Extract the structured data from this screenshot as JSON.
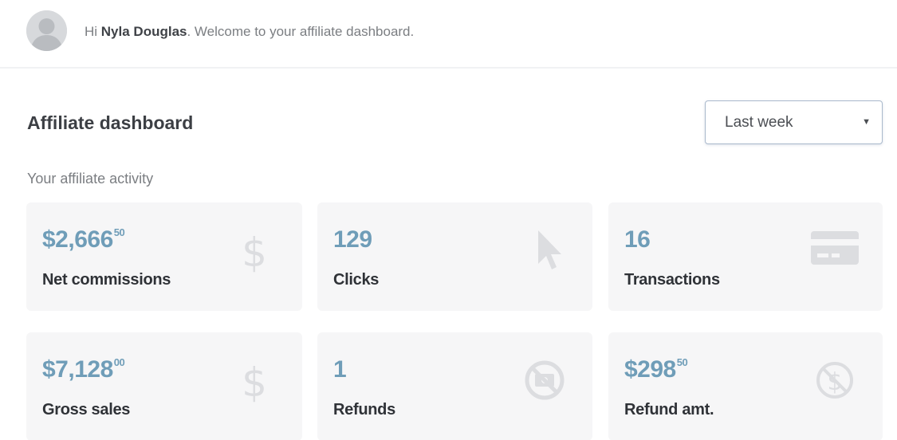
{
  "greeting": {
    "prefix": "Hi ",
    "name": "Nyla Douglas",
    "suffix": ". Welcome to your affiliate dashboard."
  },
  "dashboard": {
    "title": "Affiliate dashboard",
    "period_select": {
      "value": "Last week"
    },
    "activity_label": "Your affiliate activity"
  },
  "stats": {
    "net_commissions": {
      "main": "$2,666",
      "cents": "50",
      "label": "Net commissions",
      "icon": "dollar-icon"
    },
    "clicks": {
      "main": "129",
      "label": "Clicks",
      "icon": "cursor-icon"
    },
    "transactions": {
      "main": "16",
      "label": "Transactions",
      "icon": "credit-card-icon"
    },
    "gross_sales": {
      "main": "$7,128",
      "cents": "00",
      "label": "Gross sales",
      "icon": "dollar-icon"
    },
    "refunds": {
      "main": "1",
      "label": "Refunds",
      "icon": "no-refund-icon"
    },
    "refund_amount": {
      "main": "$298",
      "cents": "50",
      "label": "Refund amt.",
      "icon": "no-dollar-icon"
    }
  },
  "colors": {
    "value_accent": "#6f9db8",
    "card_background": "#f6f6f7",
    "icon_color": "#dcdde0"
  }
}
